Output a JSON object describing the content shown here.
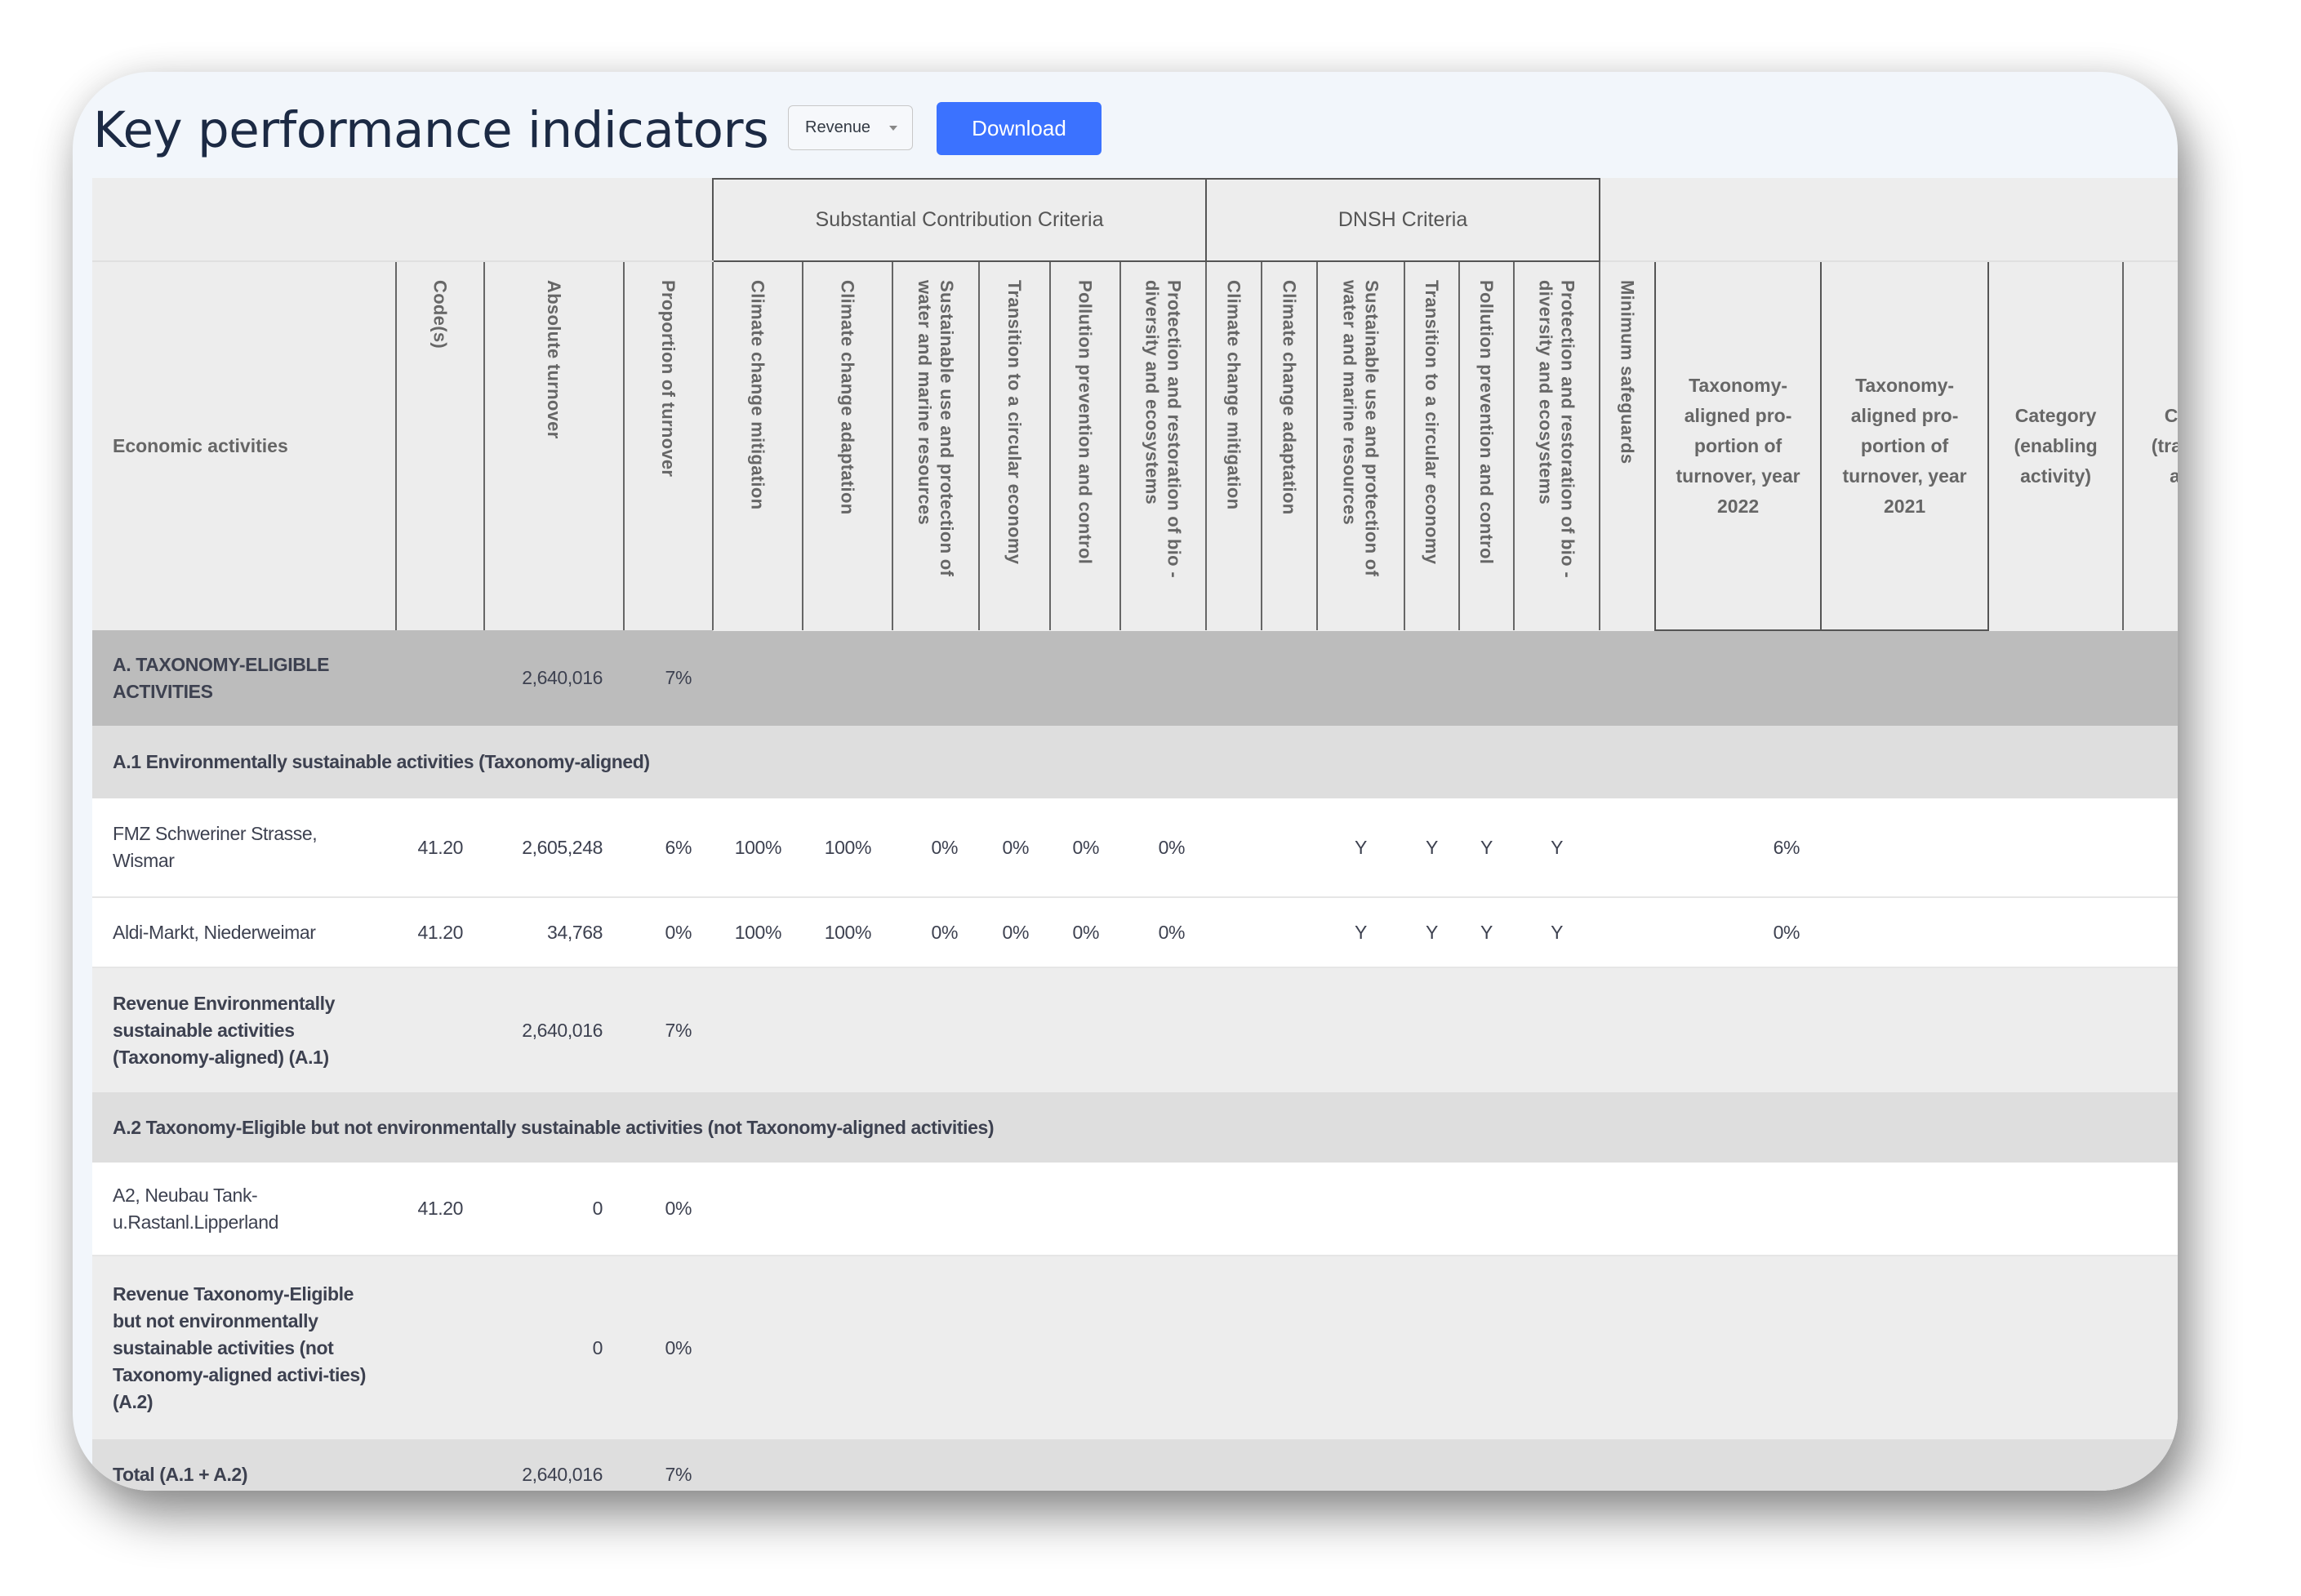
{
  "page": {
    "title": "Key performance indicators",
    "select": {
      "value": "Revenue"
    },
    "download_label": "Download",
    "accent_color": "#3b72ff"
  },
  "table": {
    "group_headers": {
      "substantial": "Substantial Contribution Criteria",
      "dnsh": "DNSH Criteria"
    },
    "columns": {
      "activity": "Economic activities",
      "code": "Code(s)",
      "absolute": "Absolute turnover",
      "proportion": "Proportion of turnover",
      "sc_mitigation": "Climate change mitigation",
      "sc_adaptation": "Climate change adaptation",
      "sc_water": "Sustainable use and protection of water and marine resources",
      "sc_circular": "Transition to a circular economy",
      "sc_pollution": "Pollution prevention and control",
      "sc_bio": "Protection and restoration of bio - diversity and ecosystems",
      "dnsh_mitigation": "Climate change mitigation",
      "dnsh_adaptation": "Climate change adaptation",
      "dnsh_water": "Sustainable use and protection of water and marine resources",
      "dnsh_circular": "Transition to a circular economy",
      "dnsh_pollution": "Pollution prevention and control",
      "dnsh_bio": "Protection and restoration of bio - diversity and ecosystems",
      "safeguards": "Minimum safeguards",
      "aligned_2022": "Taxonomy-aligned pro-portion of turnover, year 2022",
      "aligned_2021": "Taxonomy-aligned pro-portion of turnover, year 2021",
      "cat_enabling": "Category (enabling activity)",
      "cat_transitional": "Category (transitional activity)"
    },
    "rows": {
      "group_a": {
        "name": "A. TAXONOMY-ELIGIBLE ACTIVITIES",
        "absolute": "2,640,016",
        "proportion": "7%"
      },
      "section_a1": {
        "name": "A.1 Environmentally sustainable activities (Taxonomy-aligned)"
      },
      "fmz": {
        "name": "FMZ Schweriner Strasse, Wismar",
        "code": "41.20",
        "absolute": "2,605,248",
        "proportion": "6%",
        "sc_mitigation": "100%",
        "sc_adaptation": "100%",
        "sc_water": "0%",
        "sc_circular": "0%",
        "sc_pollution": "0%",
        "sc_bio": "0%",
        "dnsh_water": "Y",
        "dnsh_circular": "Y",
        "dnsh_pollution": "Y",
        "dnsh_bio": "Y",
        "aligned_2022": "6%"
      },
      "aldi": {
        "name": "Aldi-Markt, Niederweimar",
        "code": "41.20",
        "absolute": "34,768",
        "proportion": "0%",
        "sc_mitigation": "100%",
        "sc_adaptation": "100%",
        "sc_water": "0%",
        "sc_circular": "0%",
        "sc_pollution": "0%",
        "sc_bio": "0%",
        "dnsh_water": "Y",
        "dnsh_circular": "Y",
        "dnsh_pollution": "Y",
        "dnsh_bio": "Y",
        "aligned_2022": "0%"
      },
      "sum_a1": {
        "name": "Revenue Environmentally sustainable activities (Taxonomy-aligned) (A.1)",
        "absolute": "2,640,016",
        "proportion": "7%"
      },
      "section_a2": {
        "name": "A.2 Taxonomy-Eligible but not environmentally sustainable activities (not Taxonomy-aligned activities)"
      },
      "neubau": {
        "name": "A2, Neubau Tank-u.Rastanl.Lipperland",
        "code": "41.20",
        "absolute": "0",
        "proportion": "0%"
      },
      "sum_a2": {
        "name": "Revenue Taxonomy-Eligible but not environmentally sustainable activities (not Taxonomy-aligned activi-ties) (A.2)",
        "absolute": "0",
        "proportion": "0%"
      },
      "total": {
        "name": "Total (A.1 + A.2)",
        "absolute": "2,640,016",
        "proportion": "7%"
      }
    }
  }
}
